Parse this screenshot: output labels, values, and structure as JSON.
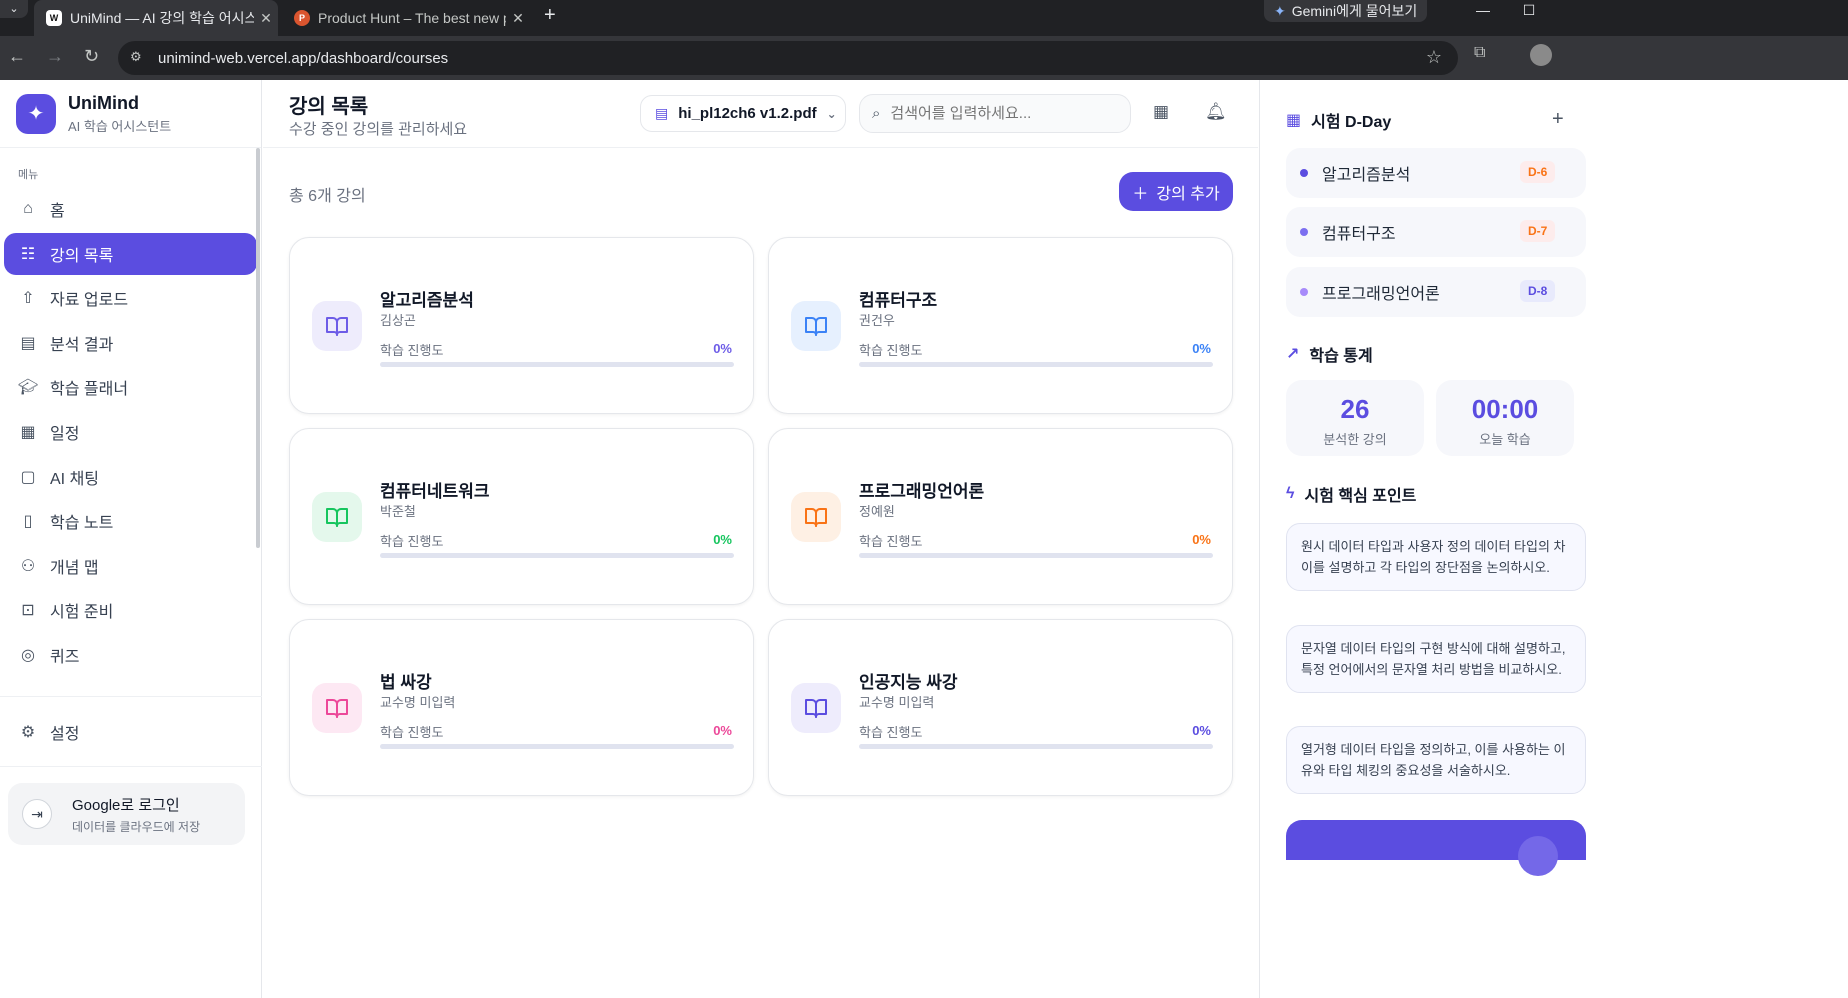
{
  "browser": {
    "tabs": [
      {
        "title": "UniMind — AI 강의 학습 어시스턴트",
        "favicon": "unimind-favicon",
        "active": true
      },
      {
        "title": "Product Hunt – The best new products",
        "favicon": "producthunt-favicon",
        "active": false
      }
    ],
    "gemini_label": "Gemini에게 물어보기",
    "url": "unimind-web.vercel.app/dashboard/courses"
  },
  "sidebar": {
    "brand_name": "UniMind",
    "brand_sub": "AI 학습 어시스턴트",
    "menu_label": "메뉴",
    "items": [
      {
        "label": "홈",
        "icon": "home-icon"
      },
      {
        "label": "강의 목록",
        "icon": "list-icon",
        "active": true
      },
      {
        "label": "자료 업로드",
        "icon": "upload-icon"
      },
      {
        "label": "분석 결과",
        "icon": "document-icon"
      },
      {
        "label": "학습 플래너",
        "icon": "graduation-cap-icon"
      },
      {
        "label": "일정",
        "icon": "calendar-icon"
      },
      {
        "label": "AI 채팅",
        "icon": "chat-icon"
      },
      {
        "label": "학습 노트",
        "icon": "note-icon"
      },
      {
        "label": "개념 맵",
        "icon": "network-icon"
      },
      {
        "label": "시험 준비",
        "icon": "book-check-icon"
      },
      {
        "label": "퀴즈",
        "icon": "target-icon"
      }
    ],
    "settings_label": "설정",
    "login_title": "Google로 로그인",
    "login_sub": "데이터를 클라우드에 저장"
  },
  "header": {
    "title": "강의 목록",
    "subtitle": "수강 중인 강의를 관리하세요",
    "file_selected": "hi_pl12ch6 v1.2.pdf",
    "search_placeholder": "검색어를 입력하세요..."
  },
  "courses_count": "총 6개 강의",
  "add_button": "강의 추가",
  "progress_label": "학습 진행도",
  "courses": [
    {
      "title": "알고리즘분석",
      "professor": "김상곤",
      "progress": "0%",
      "color": "#6d5ce7",
      "tint": "#eeecfc"
    },
    {
      "title": "컴퓨터구조",
      "professor": "권건우",
      "progress": "0%",
      "color": "#3b82f6",
      "tint": "#e6f0fe"
    },
    {
      "title": "컴퓨터네트워크",
      "professor": "박준철",
      "progress": "0%",
      "color": "#16c55e",
      "tint": "#e4f8ec"
    },
    {
      "title": "프로그래밍언어론",
      "professor": "정예원",
      "progress": "0%",
      "color": "#f97316",
      "tint": "#fef0e4"
    },
    {
      "title": "법 싸강",
      "professor": "교수명 미입력",
      "progress": "0%",
      "color": "#ec4899",
      "tint": "#fde8f3"
    },
    {
      "title": "인공지능 싸강",
      "professor": "교수명 미입력",
      "progress": "0%",
      "color": "#5b4de0",
      "tint": "#eeecfc"
    }
  ],
  "right": {
    "dday_title": "시험 D-Day",
    "exams": [
      {
        "name": "알고리즘분석",
        "dday": "D-6",
        "dot": "#5b4de0",
        "badge_bg": "#fdecec",
        "badge_fg": "#f97316"
      },
      {
        "name": "컴퓨터구조",
        "dday": "D-7",
        "dot": "#7c6ff0",
        "badge_bg": "#fdecec",
        "badge_fg": "#f97316"
      },
      {
        "name": "프로그래밍언어론",
        "dday": "D-8",
        "dot": "#a78bfa",
        "badge_bg": "#e8eafc",
        "badge_fg": "#5b4de0"
      }
    ],
    "stats_title": "학습 통계",
    "stats": [
      {
        "value": "26",
        "label": "분석한 강의"
      },
      {
        "value": "00:00",
        "label": "오늘 학습"
      }
    ],
    "keypoints_title": "시험 핵심 포인트",
    "keypoints": [
      "원시 데이터 타입과 사용자 정의 데이터 타입의 차이를 설명하고 각 타입의 장단점을 논의하시오.",
      "문자열 데이터 타입의 구현 방식에 대해 설명하고, 특정 언어에서의 문자열 처리 방법을 비교하시오.",
      "열거형 데이터 타입을 정의하고, 이를 사용하는 이유와 타입 체킹의 중요성을 서술하시오."
    ]
  }
}
